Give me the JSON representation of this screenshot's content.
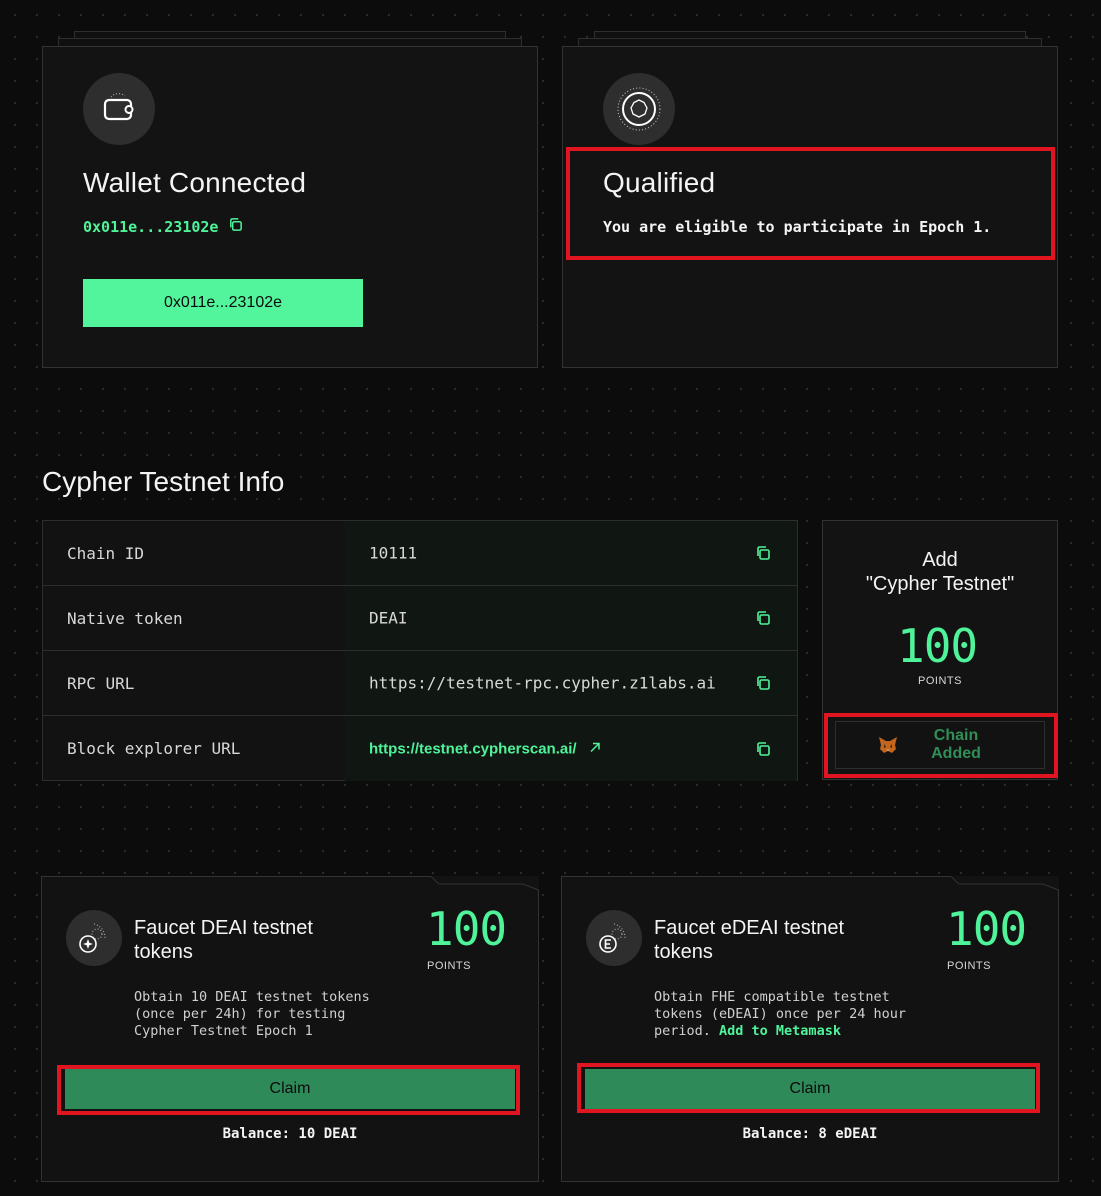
{
  "wallet": {
    "title": "Wallet Connected",
    "address_short": "0x011e...23102e",
    "button_label": "0x011e...23102e"
  },
  "qualified": {
    "title": "Qualified",
    "message": "You are eligible to participate in Epoch 1."
  },
  "testnet_info": {
    "section_title": "Cypher Testnet Info",
    "rows": [
      {
        "key": "Chain ID",
        "value": "10111"
      },
      {
        "key": "Native token",
        "value": "DEAI"
      },
      {
        "key": "RPC URL",
        "value": "https://testnet-rpc.cypher.z1labs.ai"
      },
      {
        "key": "Block explorer URL",
        "value": "https://testnet.cypherscan.ai/"
      }
    ]
  },
  "add_network": {
    "title_line1": "Add",
    "title_line2": "\"Cypher Testnet\"",
    "points_value": "100",
    "points_label": "POINTS",
    "button_line1": "Chain",
    "button_line2": "Added"
  },
  "faucets": [
    {
      "title_line1": "Faucet DEAI testnet",
      "title_line2": "tokens",
      "points_value": "100",
      "points_label": "POINTS",
      "desc": "Obtain 10 DEAI testnet tokens\n(once per 24h) for testing\nCypher Testnet Epoch 1",
      "claim_label": "Claim",
      "balance": "Balance: 10 DEAI"
    },
    {
      "title_line1": "Faucet eDEAI testnet",
      "title_line2": "tokens",
      "points_value": "100",
      "points_label": "POINTS",
      "desc": "Obtain FHE compatible testnet\ntokens (eDEAI) once per 24 hour\nperiod. ",
      "desc_link": "Add to Metamask",
      "claim_label": "Claim",
      "balance": "Balance: 8 eDEAI"
    }
  ],
  "colors": {
    "accent_green": "#4ff39a",
    "claim_green": "#2f8a59",
    "highlight_red": "#e1151f",
    "background": "#0c0c0c"
  }
}
